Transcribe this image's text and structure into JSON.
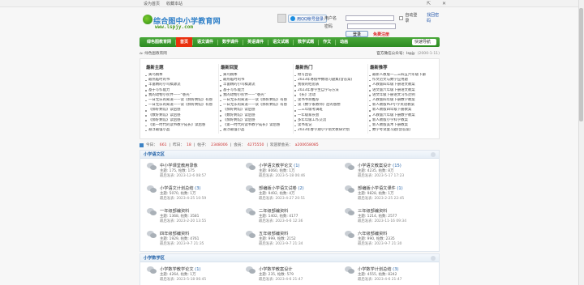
{
  "topbar": {
    "home": "设为首页",
    "favorite": "收藏本站"
  },
  "site": {
    "title": "综合图中小学教育网",
    "url": "www.lspjy.com"
  },
  "login": {
    "qq_button": "用QQ帐号登录",
    "username_label": "用户名",
    "password_label": "密码",
    "auto_login": "自动登录",
    "forgot": "找回密码",
    "login_button": "登录",
    "register": "免费注册"
  },
  "nav": {
    "items": [
      "绿色图教育网",
      "首页",
      "语文课件",
      "数学课件",
      "英语课件",
      "语文试题",
      "数学试题",
      "作文",
      "动画"
    ],
    "search": "快速导航"
  },
  "crumb": {
    "text": "› 绿色图教育网",
    "right_label": "官方微信公众号：",
    "right_value": "lspjy",
    "date": "(2000-1-11)"
  },
  "links": {
    "col1": {
      "title": "最新主题",
      "items": [
        "黄鸟稿本",
        "最热临时的书",
        "丰富精的小鸟稿源流",
        "基于写作能力",
        "我的动物小伙伴——“巷壳”",
        "一日无乐的知道——读《郝好剩馆》有感",
        "一日无乐的知道——读《郝好剩馆》有感",
        "《郝好剩馆》读后感",
        "《数好剩馆》读后感",
        "《郝好剩馆》读后感",
        "《第一时代的读书教学成长》读后感",
        "悬浮最强小品"
      ]
    },
    "col2": {
      "title": "最新回复",
      "items": [
        "黄鸟稿本",
        "最热临时的书",
        "丰富精的小鸟稿源流",
        "基于写作能力",
        "我的动物小伙伴——“巷壳”",
        "一日无乐的知道——读《郝好剩馆》有感",
        "一日无乐的知道——读《郝好剩馆》有感",
        "《郝好剩馆》读后感",
        "《数好剩馆》读后感",
        "《郝好剩馆》读后感",
        "《第一时代的读书教学成长》读后感",
        "悬浮最强小品"
      ]
    },
    "col3": {
      "title": "最新热门",
      "items": [
        "继写回答",
        "2023年寒假中数理习题集(含答案)",
        "我很的经验表",
        "2023年春学生自学与方法",
        "《长》活动",
        "读书书目推荐",
        "读《数学家教师》后的感想",
        "二三年级考满班",
        "一年级家长会",
        "多年年级工作交流",
        "读书笔记",
        "2023年春学期小学语文教研计划"
      ]
    },
    "col4": {
      "title": "最新推荐",
      "items": [
        "最新人教版一二三四五六年级下册",
        "作文范文与数学应用题",
        "人教版四年级下册语文教案",
        "语文版六年级下册语文教案",
        "语文年级下册语文习作范例",
        "人教版四年级下册数学教案",
        "新人教版PEP小学英语教案",
        "新人教版四年级下册教案",
        "人教版六年级下册数学教案",
        "新人教版小学科学教案",
        "新人教版美术下册教案",
        "数学考试复习题(含答案)"
      ]
    }
  },
  "stats": {
    "today_label": "今日：",
    "today": "661",
    "yesterday_label": "昨日：",
    "yesterday": "18",
    "posts_label": "帖子：",
    "posts": "2348006",
    "members_label": "会员：",
    "members": "4275550",
    "newest_label": "欢迎新会员：",
    "newest": "a200658085"
  },
  "forum1": {
    "title": "小学语文区",
    "boards": [
      {
        "name": "中小学课堂教用录像",
        "count": "",
        "stats": "主题: 175, 帖数: 175",
        "last": "最后发表: 2023-12-6 08:57"
      },
      {
        "name": "小学语文教学论文",
        "count": "(1)",
        "stats": "主题: 8060, 帖数: 1万",
        "last": "最后发表: 2023-5-18 06:46"
      },
      {
        "name": "小学语文教案设计",
        "count": "(15)",
        "stats": "主题: 4235, 帖数: 8万",
        "last": "最后发表: 2023-5-17 17:23"
      },
      {
        "name": "小学语文计划总结",
        "count": "(3)",
        "stats": "主题: 5070, 帖数: 1万",
        "last": "最后发表: 2023-4-25 10:59"
      },
      {
        "name": "部编版小学语文试卷",
        "count": "(2)",
        "stats": "主题: 9492, 帖数: 4万",
        "last": "最后发表: 2023-4-27 20:51"
      },
      {
        "name": "部编版小学语文课件",
        "count": "(1)",
        "stats": "主题: 9828, 帖数: 1万",
        "last": "最后发表: 2023-2-25 22:45"
      },
      {
        "name": "一年级部编资料",
        "count": "",
        "stats": "主题: 1368, 帖数: 3581",
        "last": "最后发表: 2023-2-20 13:55"
      },
      {
        "name": "二年级部编资料",
        "count": "",
        "stats": "主题: 1402, 帖数: 4177",
        "last": "最后发表: 2023-4-6 12:36"
      },
      {
        "name": "三年级部编资料",
        "count": "",
        "stats": "主题: 1214, 帖数: 2577",
        "last": "最后发表: 2023-11-16 09:34"
      },
      {
        "name": "四年级部编资料",
        "count": "",
        "stats": "主题: 1929, 帖数: 4761",
        "last": "最后发表: 2023-9-7 21:35"
      },
      {
        "name": "五年级部编资料",
        "count": "",
        "stats": "主题: 999, 帖数: 2152",
        "last": "最后发表: 2023-9-7 21:34"
      },
      {
        "name": "六年级部编资料",
        "count": "",
        "stats": "主题: 990, 帖数: 2335",
        "last": "最后发表: 2023-9-7 21:30"
      }
    ]
  },
  "forum2": {
    "title": "小学数学区",
    "boards": [
      {
        "name": "小学数学教学论文",
        "count": "(1)",
        "stats": "主题: 4264, 帖数: 1万",
        "last": "最后发表: 2023-5-18 06:45"
      },
      {
        "name": "小学数学教案设计",
        "count": "",
        "stats": "主题: 235, 帖数: 579",
        "last": "最后发表: 2023-4-6 21:47"
      },
      {
        "name": "小学数学计划总结",
        "count": "(3)",
        "stats": "主题: 4555, 帖数: 8242",
        "last": "最后发表: 2023-4-6 21:47"
      }
    ]
  }
}
